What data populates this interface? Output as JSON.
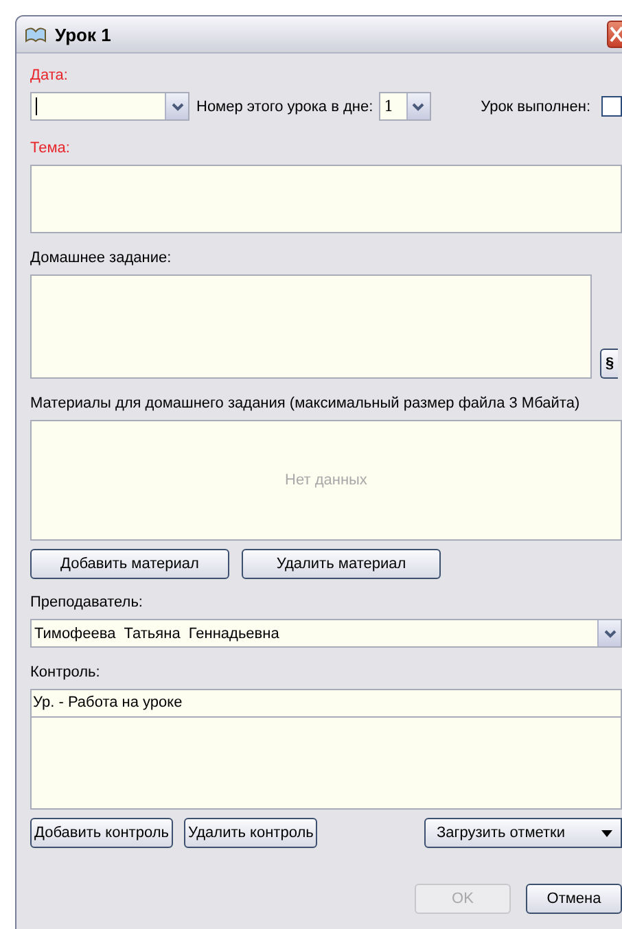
{
  "window": {
    "title": "Урок 1"
  },
  "date": {
    "label": "Дата:",
    "required": true,
    "focused": true
  },
  "lesson_number": {
    "label": "Номер этого урока в дне:",
    "value": "1"
  },
  "completed": {
    "label": "Урок выполнен:",
    "checked": false
  },
  "topic": {
    "label": "Тема:",
    "required": true
  },
  "homework": {
    "label": "Домашнее задание:",
    "required": false,
    "side_button": "§"
  },
  "materials": {
    "label": "Материалы для домашнего задания (максимальный размер файла 3 Мбайта)",
    "empty_text": "Нет данных",
    "buttons": [
      {
        "label": "Добавить материал"
      },
      {
        "label": "Удалить материал"
      }
    ]
  },
  "teacher": {
    "label": "Преподаватель:",
    "required": false,
    "value": "Тимофеева  Татьяна  Геннадьевна"
  },
  "control": {
    "label": "Контроль:",
    "required": false,
    "rows": [
      {
        "text": "Ур. - Работа на уроке"
      }
    ],
    "buttons": [
      {
        "label": "Добавить контроль"
      },
      {
        "label": "Удалить контроль"
      }
    ],
    "menu_button": "Загрузить отметки"
  },
  "footer": {
    "buttons": [
      {
        "label": "OK",
        "disabled": true
      },
      {
        "label": "Отмена",
        "disabled": false
      }
    ]
  }
}
